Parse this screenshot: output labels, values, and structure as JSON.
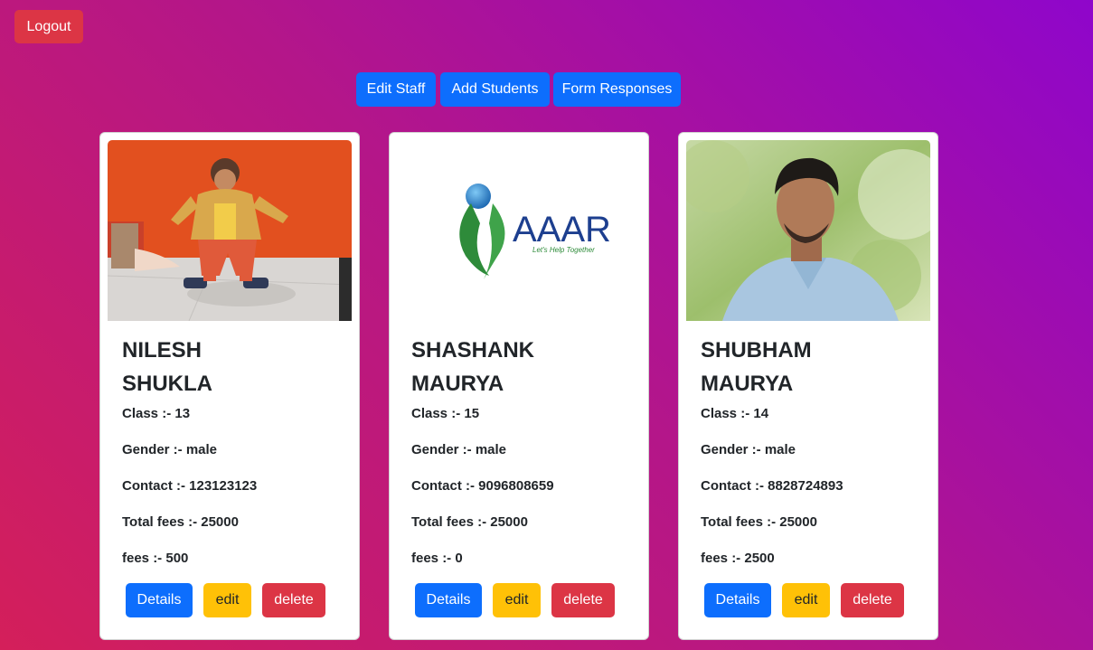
{
  "header": {
    "logout_label": "Logout"
  },
  "nav": {
    "edit_staff": "Edit Staff",
    "add_students": "Add Students",
    "form_responses": "Form Responses"
  },
  "logo": {
    "text": "AAAR",
    "tagline": "Let's Help Together"
  },
  "field_labels": {
    "class": "Class :-",
    "gender": "Gender :-",
    "contact": "Contact :-",
    "total_fees": "Total fees :-",
    "fees": "fees :-"
  },
  "card_buttons": {
    "details": "Details",
    "edit": "edit",
    "delete": "delete"
  },
  "students": [
    {
      "first_name": "NILESH",
      "last_name": "SHUKLA",
      "class_line": "Class :- 13",
      "gender_line": "Gender :- male",
      "contact_line": "Contact :- 123123123",
      "total_fees_line": "Total fees :- 25000",
      "fees_line": "fees :- 500",
      "image": "photo-child"
    },
    {
      "first_name": "SHASHANK",
      "last_name": "MAURYA",
      "class_line": "Class :- 15",
      "gender_line": "Gender :- male",
      "contact_line": "Contact :- 9096808659",
      "total_fees_line": "Total fees :- 25000",
      "fees_line": "fees :- 0",
      "image": "logo-aaar"
    },
    {
      "first_name": "SHUBHAM",
      "last_name": "MAURYA",
      "class_line": "Class :- 14",
      "gender_line": "Gender :- male",
      "contact_line": "Contact :- 8828724893",
      "total_fees_line": "Total fees :- 25000",
      "fees_line": "fees :- 2500",
      "image": "photo-young-man"
    }
  ],
  "colors": {
    "primary": "#0d6efd",
    "danger": "#dc3545",
    "warning": "#ffc107"
  }
}
